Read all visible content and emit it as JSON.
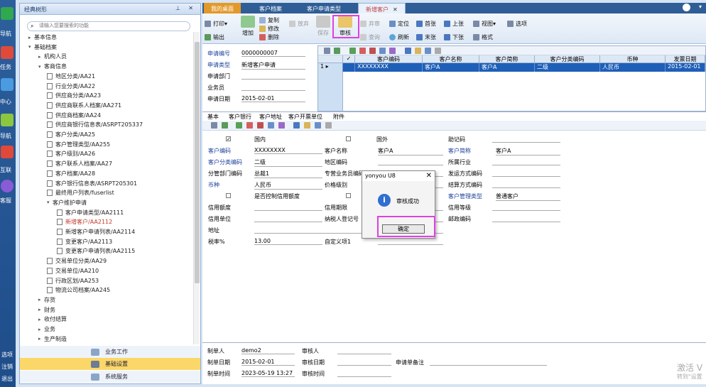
{
  "leftnav": {
    "items": [
      "导航",
      "任务",
      "中心",
      "导航",
      "互联",
      "客服"
    ],
    "bottom": [
      "选项",
      "注销",
      "退出"
    ]
  },
  "tree": {
    "title": "经典树形",
    "search_placeholder": "请输入您要搜索的功能",
    "nodes": [
      {
        "label": "基本信息",
        "level": 1,
        "toggle": "▸"
      },
      {
        "label": "基础档案",
        "level": 1,
        "toggle": "▾"
      },
      {
        "label": "机构人员",
        "level": 2,
        "toggle": "▸"
      },
      {
        "label": "客商信息",
        "level": 2,
        "toggle": "▾"
      },
      {
        "label": "地区分类/AA21",
        "level": 3
      },
      {
        "label": "行业分类/AA22",
        "level": 3
      },
      {
        "label": "供应商分类/AA23",
        "level": 3
      },
      {
        "label": "供应商联系人档案/AA271",
        "level": 3
      },
      {
        "label": "供应商档案/AA24",
        "level": 3
      },
      {
        "label": "供应商银行信息表/ASRPT205337",
        "level": 3
      },
      {
        "label": "客户分类/AA25",
        "level": 3
      },
      {
        "label": "客户管理类型/AA255",
        "level": 3
      },
      {
        "label": "客户级别/AA26",
        "level": 3
      },
      {
        "label": "客户联系人档案/AA27",
        "level": 3
      },
      {
        "label": "客户档案/AA28",
        "level": 3
      },
      {
        "label": "客户银行信息表/ASRPT205301",
        "level": 3
      },
      {
        "label": "最终用户列表/fuserlist",
        "level": 3
      },
      {
        "label": "客户维护申请",
        "level": 3,
        "toggle": "▾"
      },
      {
        "label": "客户申请类型/AA2111",
        "level": 4
      },
      {
        "label": "新增客户/AA2112",
        "level": 4,
        "selected": true
      },
      {
        "label": "新增客户申请列表/AA2114",
        "level": 4
      },
      {
        "label": "变更客户/AA2113",
        "level": 4
      },
      {
        "label": "变更客户申请列表/AA2115",
        "level": 4
      },
      {
        "label": "交易单位分类/AA29",
        "level": 3
      },
      {
        "label": "交易单位/AA210",
        "level": 3
      },
      {
        "label": "行政区划/AA253",
        "level": 3
      },
      {
        "label": "物流公司档案/AA245",
        "level": 3
      },
      {
        "label": "存货",
        "level": 2,
        "toggle": "▸"
      },
      {
        "label": "财务",
        "level": 2,
        "toggle": "▸"
      },
      {
        "label": "收付结算",
        "level": 2,
        "toggle": "▸"
      },
      {
        "label": "业务",
        "level": 2,
        "toggle": "▸"
      },
      {
        "label": "生产制造",
        "level": 2,
        "toggle": "▸"
      }
    ],
    "bottom_tabs": [
      "业务工作",
      "基础设置",
      "系统服务"
    ]
  },
  "tabs": [
    "我的桌面",
    "客户档案",
    "客户申请类型",
    "新增客户"
  ],
  "toolbar": {
    "print": "打印",
    "export": "输出",
    "add": "增加",
    "copy": "复制",
    "modify": "修改",
    "delete": "删除",
    "abandon": "放弃",
    "save": "保存",
    "audit": "审核",
    "unaudit": "弃审",
    "query": "查询",
    "locate": "定位",
    "refresh": "刷新",
    "first": "首张",
    "last": "末张",
    "prev": "上张",
    "next": "下张",
    "view": "视图",
    "format": "格式",
    "options": "选项"
  },
  "head": {
    "apply_no_label": "申请编号",
    "apply_no": "0000000007",
    "apply_type_label": "申请类型",
    "apply_type": "新增客户申请",
    "dept_label": "申请部门",
    "dept": "",
    "staff_label": "业务员",
    "staff": "",
    "date_label": "申请日期",
    "date": "2015-02-01"
  },
  "grid": {
    "headers": [
      "客户编码",
      "客户名称",
      "客户简称",
      "客户分类编码",
      "币种",
      "发票日期"
    ],
    "row": [
      "XXXXXXXX",
      "客户A",
      "客户A",
      "二级",
      "人民币",
      "2015-02-01"
    ],
    "row_no": "1"
  },
  "subtabs": [
    "基本",
    "客户银行",
    "客户地址",
    "客户开票单位",
    "附件"
  ],
  "body": {
    "domestic": "国内",
    "foreign": "国外",
    "mnemonic": "助记码",
    "cust_code_label": "客户编码",
    "cust_code": "XXXXXXXX",
    "cust_name_label": "客户名称",
    "cust_name": "客户A",
    "cust_abbr_label": "客户简称",
    "cust_abbr": "客户A",
    "cust_class_label": "客户分类编码",
    "cust_class": "二级",
    "region_label": "地区编码",
    "industry_label": "所属行业",
    "branch_label": "分管部门编码",
    "branch": "总裁1",
    "exclusive_label": "专营业务员编码",
    "ship_label": "发运方式编码",
    "currency_label": "币种",
    "currency": "人民币",
    "price_label": "价格级别",
    "settle_label": "结算方式编码",
    "credit_ctrl_label": "是否控制信用额度",
    "cust_mgmt_label": "客户管理类型",
    "cust_mgmt": "普通客户",
    "credit_limit_label": "信用额度",
    "credit_term_label": "信用期限",
    "credit_level_label": "信用等级",
    "credit_unit_label": "信用单位",
    "taxpayer_label": "纳税人登记号",
    "postcode_label": "邮政编码",
    "address_label": "地址",
    "tax_label": "税率%",
    "tax": "13.00",
    "custom1_label": "自定义项1"
  },
  "footer": {
    "maker_label": "制单人",
    "maker": "demo2",
    "auditor_label": "审核人",
    "make_date_label": "制单日期",
    "make_date": "2015-02-01",
    "audit_date_label": "审核日期",
    "remark_label": "申请单备注",
    "make_time_label": "制单时间",
    "make_time": "2023-05-19  13:27",
    "audit_time_label": "审核时间"
  },
  "dialog": {
    "title": "yonyou U8",
    "message": "审核成功",
    "ok": "确定"
  },
  "watermark": {
    "line1": "激活 V",
    "line2": "转到\"设置"
  }
}
